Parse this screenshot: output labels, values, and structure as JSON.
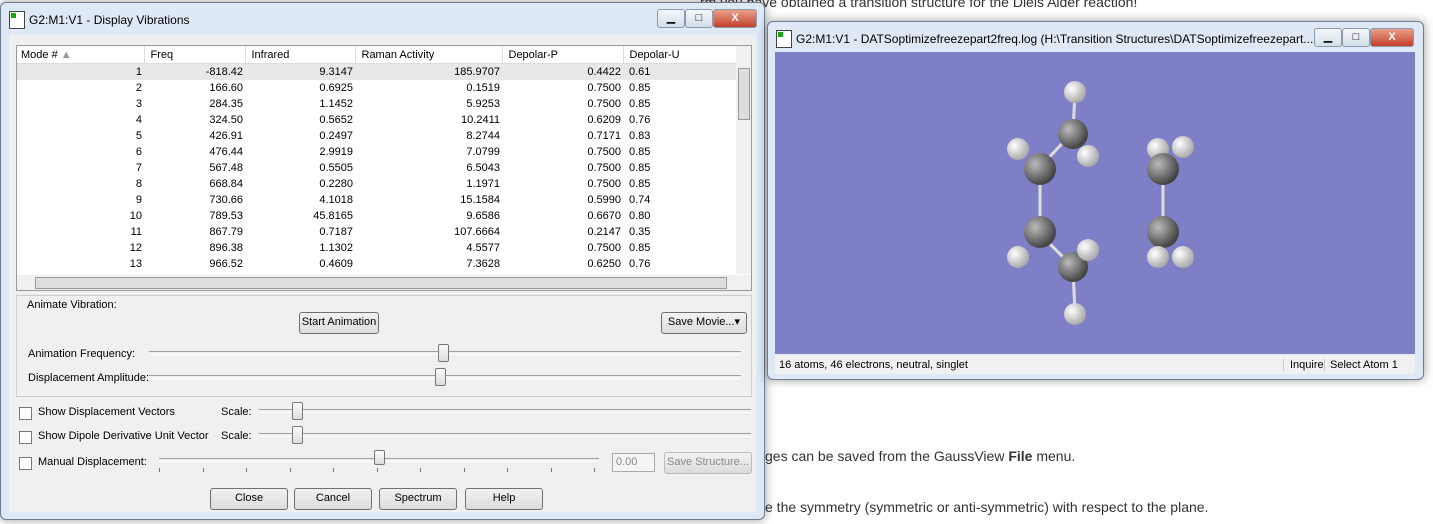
{
  "background": {
    "line1": "rm you have obtained a transition structure for the Diels Alder reaction!",
    "line2": "ges can be saved from the GaussView ",
    "line2_bold": "File",
    "line2_end": " menu.",
    "line3": "e the symmetry (symmetric or anti-symmetric) with respect to the plane."
  },
  "vib_dialog": {
    "title": "G2:M1:V1 - Display Vibrations",
    "columns": [
      "Mode #",
      "Freq",
      "Infrared",
      "Raman Activity",
      "Depolar-P",
      "Depolar-U"
    ],
    "rows": [
      [
        "1",
        "-818.42",
        "9.3147",
        "185.9707",
        "0.4422",
        "0.61"
      ],
      [
        "2",
        "166.60",
        "0.6925",
        "0.1519",
        "0.7500",
        "0.85"
      ],
      [
        "3",
        "284.35",
        "1.1452",
        "5.9253",
        "0.7500",
        "0.85"
      ],
      [
        "4",
        "324.50",
        "0.5652",
        "10.2411",
        "0.6209",
        "0.76"
      ],
      [
        "5",
        "426.91",
        "0.2497",
        "8.2744",
        "0.7171",
        "0.83"
      ],
      [
        "6",
        "476.44",
        "2.9919",
        "7.0799",
        "0.7500",
        "0.85"
      ],
      [
        "7",
        "567.48",
        "0.5505",
        "6.5043",
        "0.7500",
        "0.85"
      ],
      [
        "8",
        "668.84",
        "0.2280",
        "1.1971",
        "0.7500",
        "0.85"
      ],
      [
        "9",
        "730.66",
        "4.1018",
        "15.1584",
        "0.5990",
        "0.74"
      ],
      [
        "10",
        "789.53",
        "45.8165",
        "9.6586",
        "0.6670",
        "0.80"
      ],
      [
        "11",
        "867.79",
        "0.7187",
        "107.6664",
        "0.2147",
        "0.35"
      ],
      [
        "12",
        "896.38",
        "1.1302",
        "4.5577",
        "0.7500",
        "0.85"
      ],
      [
        "13",
        "966.52",
        "0.4609",
        "7.3628",
        "0.6250",
        "0.76"
      ]
    ],
    "animate_label": "Animate Vibration:",
    "start_animation": "Start Animation",
    "save_movie": "Save Movie...",
    "anim_freq_label": "Animation Frequency:",
    "disp_amp_label": "Displacement Amplitude:",
    "show_disp_vectors": "Show Displacement Vectors",
    "show_dipole": "Show Dipole Derivative Unit Vector",
    "scale_label": "Scale:",
    "manual_disp": "Manual Displacement:",
    "manual_value": "0.00",
    "save_structure": "Save Structure...",
    "buttons": {
      "close": "Close",
      "cancel": "Cancel",
      "spectrum": "Spectrum",
      "help": "Help"
    }
  },
  "mol_window": {
    "title": "G2:M1:V1 - DATSoptimizefreezepart2freq.log (H:\\Transition Structures\\DATSoptimizefreezepart...",
    "status": "16 atoms, 46 electrons, neutral, singlet",
    "mode": "Inquire",
    "select": "Select Atom 1",
    "viewport_color": "#7f7fc8"
  }
}
